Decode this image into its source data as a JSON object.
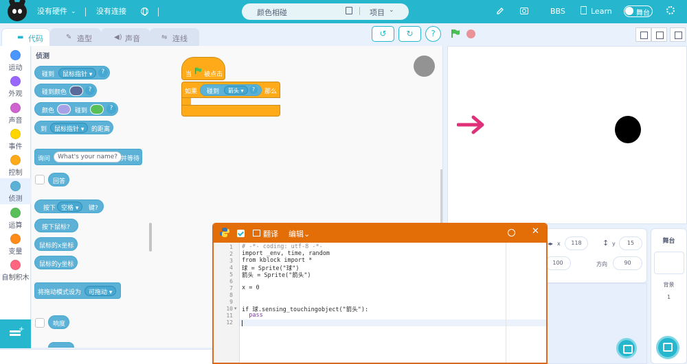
{
  "topbar": {
    "hardware": "没有硬件",
    "connection": "没有连接",
    "project_name": "颜色相碰",
    "project_menu": "项目",
    "bbs": "BBS",
    "learn": "Learn",
    "stage_toggle": "舞台"
  },
  "tabs": {
    "code": "代码",
    "costume": "造型",
    "sound": "声音",
    "connect": "连线"
  },
  "categories": [
    {
      "label": "运动",
      "color": "#4c97ff"
    },
    {
      "label": "外观",
      "color": "#9966ff"
    },
    {
      "label": "声音",
      "color": "#cf63cf"
    },
    {
      "label": "事件",
      "color": "#ffd500"
    },
    {
      "label": "控制",
      "color": "#ffab19"
    },
    {
      "label": "侦测",
      "color": "#5cb1d6"
    },
    {
      "label": "运算",
      "color": "#59c059"
    },
    {
      "label": "变量",
      "color": "#ff8c1a"
    },
    {
      "label": "自制积木",
      "color": "#ff6680"
    }
  ],
  "palette": {
    "title": "侦测",
    "touching": "碰到",
    "touching_dd": "鼠标指针",
    "touching_color": "碰到颜色",
    "color": "颜色",
    "color_touch": "碰到",
    "distance_to": "到",
    "distance_dd": "鼠标指针",
    "distance_suffix": "的距离",
    "ask": "询问",
    "ask_default": "What's your name?",
    "ask_wait": "并等待",
    "answer": "回答",
    "key_pressed": "按下",
    "key_dd": "空格",
    "key_suffix": "键?",
    "mouse_down": "按下鼠标?",
    "mouse_x": "鼠标的x坐标",
    "mouse_y": "鼠标的y坐标",
    "drag_mode": "将拖动模式设为",
    "drag_dd": "可拖动",
    "loudness": "响度",
    "qmark": "?"
  },
  "script": {
    "when": "当",
    "clicked": "被点击",
    "if": "如果",
    "touch": "碰到",
    "target": "箭头",
    "then": "那么",
    "qmark": "?"
  },
  "sprite_info": {
    "x_label": "x",
    "x_value": "118",
    "y_label": "y",
    "y_value": "15",
    "size_value": "100",
    "direction_label": "方向",
    "direction_value": "90"
  },
  "stage_panel": {
    "title": "舞台",
    "backdrop_label": "背景",
    "backdrop_count": "1"
  },
  "python": {
    "translate": "翻译",
    "edit": "编辑",
    "line_numbers": [
      "1",
      "2",
      "3",
      "4",
      "5",
      "6",
      "7",
      "8",
      "9",
      "10",
      "11",
      "12"
    ],
    "lines": [
      "# -*- coding: utf-8 -*-",
      "import _env, time, random",
      "from kblock import *",
      "球 = Sprite(\"球\")",
      "箭头 = Sprite(\"箭头\")",
      "",
      "x = 0",
      "",
      "",
      "if 球.sensing_touchingobject(\"箭头\"):",
      "  pass",
      ""
    ]
  },
  "colors": {
    "accent": "#26b7ce",
    "sensing": "#5cb1d6",
    "control": "#ffab19",
    "python_header": "#e36d07"
  }
}
